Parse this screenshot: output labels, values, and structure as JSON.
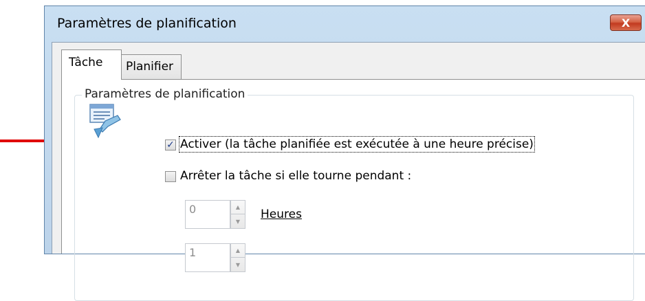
{
  "window": {
    "title": "Paramètres de planification",
    "close_glyph": "X"
  },
  "tabs": [
    {
      "label": "Tâche",
      "active": true
    },
    {
      "label": "Planifier",
      "active": false
    }
  ],
  "group": {
    "legend": "Paramètres de planification",
    "icon": "scheduled-task-icon"
  },
  "options": {
    "enable": {
      "label": "Activer (la tâche planifiée est exécutée à une heure précise)",
      "checked": true,
      "check_glyph": "✓"
    },
    "stop_if_running": {
      "label": "Arrêter la tâche si elle tourne pendant :",
      "checked": false
    }
  },
  "duration": {
    "hours": {
      "value": "0",
      "label": "Heures"
    },
    "minutes": {
      "value": "1"
    }
  },
  "annotation": {
    "arrow_color": "#e00000"
  },
  "colors": {
    "close_button": "#c23a20",
    "check_mark": "#1e3b8a"
  }
}
